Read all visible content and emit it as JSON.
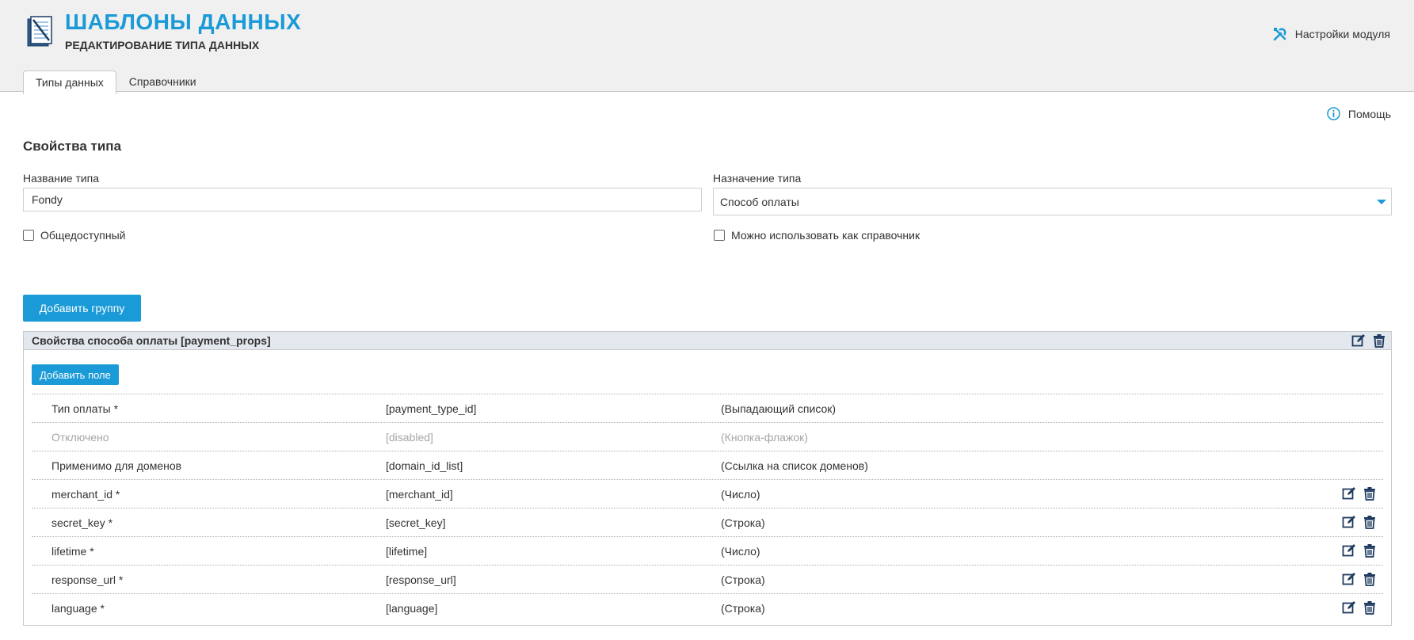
{
  "header": {
    "title": "ШАБЛОНЫ ДАННЫХ",
    "subtitle": "РЕДАКТИРОВАНИЕ ТИПА ДАННЫХ",
    "module_settings_label": "Настройки модуля"
  },
  "tabs": [
    {
      "label": "Типы данных",
      "active": true
    },
    {
      "label": "Справочники",
      "active": false
    }
  ],
  "help_label": "Помощь",
  "form": {
    "section_title": "Свойства типа",
    "type_name_label": "Название типа",
    "type_name_value": "Fondy",
    "type_purpose_label": "Назначение типа",
    "type_purpose_value": "Способ оплаты",
    "public_label": "Общедоступный",
    "as_reference_label": "Можно использовать как справочник",
    "add_group_label": "Добавить группу"
  },
  "group": {
    "title": "Свойства способа оплаты [payment_props]",
    "add_field_label": "Добавить поле",
    "fields": [
      {
        "name": "Тип оплаты *",
        "code": "[payment_type_id]",
        "type": "(Выпадающий список)",
        "disabled": false,
        "editable": false
      },
      {
        "name": "Отключено",
        "code": "[disabled]",
        "type": "(Кнопка-флажок)",
        "disabled": true,
        "editable": false
      },
      {
        "name": "Применимо для доменов",
        "code": "[domain_id_list]",
        "type": "(Ссылка на список доменов)",
        "disabled": false,
        "editable": false
      },
      {
        "name": "merchant_id *",
        "code": "[merchant_id]",
        "type": "(Число)",
        "disabled": false,
        "editable": true
      },
      {
        "name": "secret_key *",
        "code": "[secret_key]",
        "type": "(Строка)",
        "disabled": false,
        "editable": true
      },
      {
        "name": "lifetime *",
        "code": "[lifetime]",
        "type": "(Число)",
        "disabled": false,
        "editable": true
      },
      {
        "name": "response_url *",
        "code": "[response_url]",
        "type": "(Строка)",
        "disabled": false,
        "editable": true
      },
      {
        "name": "language *",
        "code": "[language]",
        "type": "(Строка)",
        "disabled": false,
        "editable": true
      }
    ]
  },
  "colors": {
    "accent": "#1a9ad6",
    "header_bg": "#f0f0f0",
    "group_header_bg": "#e3e7ee",
    "icon_dark": "#1e3a5f"
  }
}
